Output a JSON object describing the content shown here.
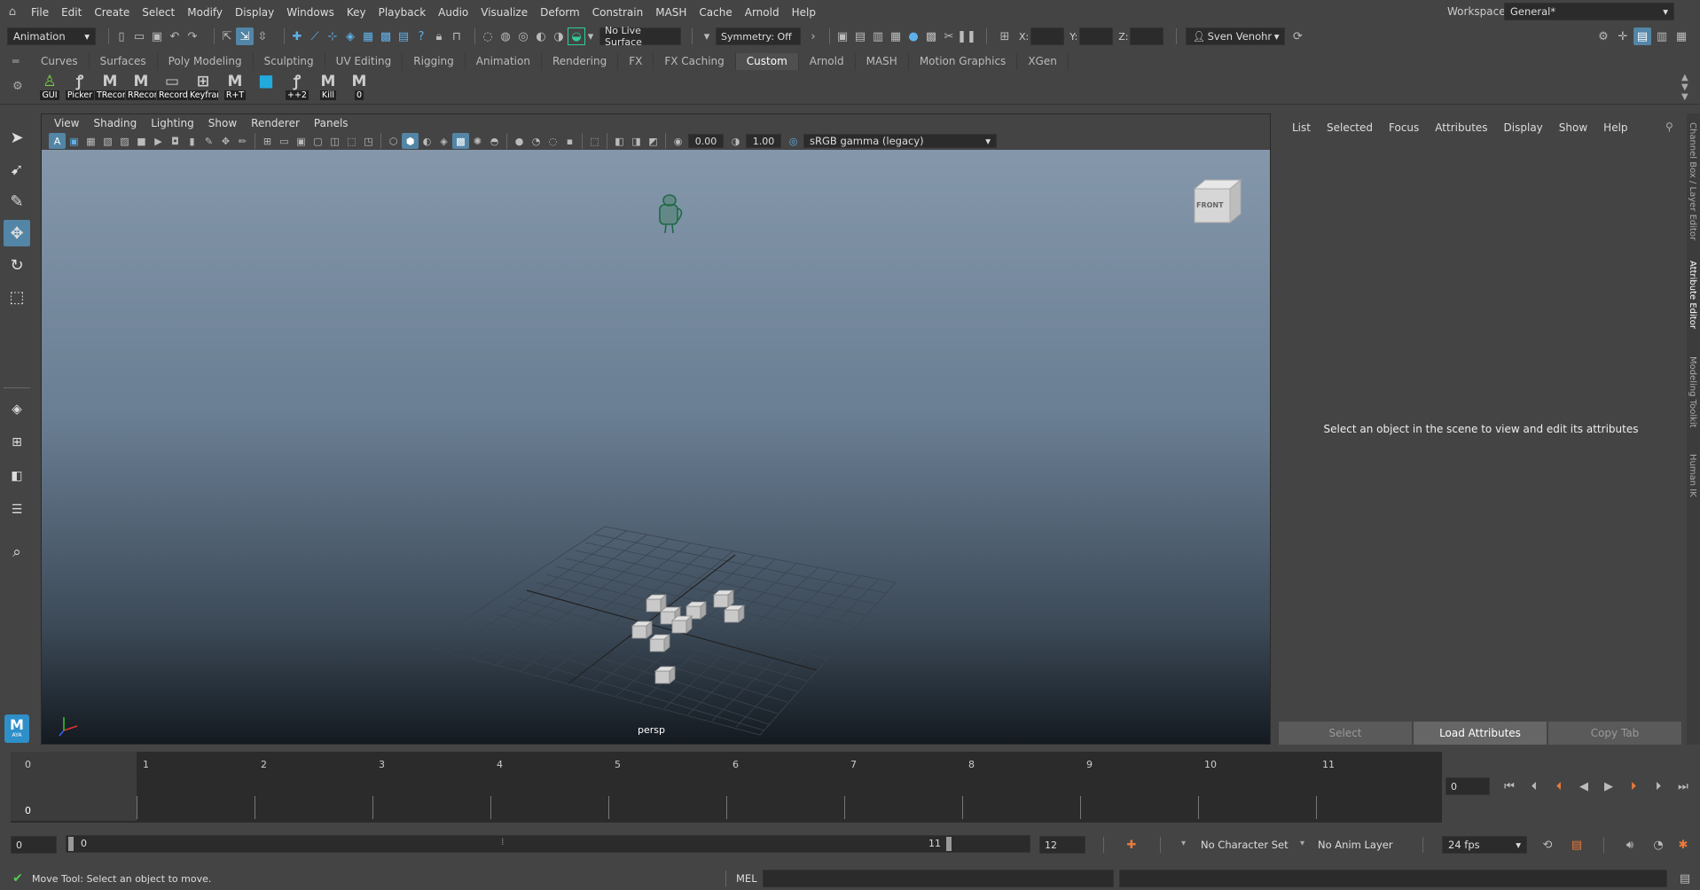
{
  "menubar": {
    "items": [
      "File",
      "Edit",
      "Create",
      "Select",
      "Modify",
      "Display",
      "Windows",
      "Key",
      "Playback",
      "Audio",
      "Visualize",
      "Deform",
      "Constrain",
      "MASH",
      "Cache",
      "Arnold",
      "Help"
    ],
    "workspace_label": "Workspace:",
    "workspace_value": "General*"
  },
  "statusline": {
    "menuset": "Animation",
    "live_surface": "No Live Surface",
    "symmetry": "Symmetry: Off",
    "x_label": "X:",
    "y_label": "Y:",
    "z_label": "Z:",
    "user": "Sven Venohr"
  },
  "shelf_tabs": [
    "Curves",
    "Surfaces",
    "Poly Modeling",
    "Sculpting",
    "UV Editing",
    "Rigging",
    "Animation",
    "Rendering",
    "FX",
    "FX Caching",
    "Custom",
    "Arnold",
    "MASH",
    "Motion Graphics",
    "XGen"
  ],
  "shelf_active_tab": "Custom",
  "shelf_buttons": [
    {
      "label": "GUI",
      "icon": "person-icon"
    },
    {
      "label": "Picker",
      "icon": "python-icon"
    },
    {
      "label": "TRecord",
      "icon": "mel-icon"
    },
    {
      "label": "RRecord",
      "icon": "mel-icon"
    },
    {
      "label": "Record",
      "icon": "record-icon"
    },
    {
      "label": "Keyframe",
      "icon": "keyframe-icon"
    },
    {
      "label": "R+T",
      "icon": "mel-icon"
    },
    {
      "label": "",
      "icon": "cube-icon"
    },
    {
      "label": "++2",
      "icon": "python-icon"
    },
    {
      "label": "Kill",
      "icon": "mel-icon"
    },
    {
      "label": "0",
      "icon": "mel-icon"
    }
  ],
  "viewport": {
    "menus": [
      "View",
      "Shading",
      "Lighting",
      "Show",
      "Renderer",
      "Panels"
    ],
    "exposure": "0.00",
    "gamma": "1.00",
    "color_space": "sRGB gamma (legacy)",
    "camera_label": "persp",
    "viewcube_label": "FRONT"
  },
  "attribute_editor": {
    "menus": [
      "List",
      "Selected",
      "Focus",
      "Attributes",
      "Display",
      "Show",
      "Help"
    ],
    "empty_message": "Select an object in the scene to view and edit its attributes",
    "btn_select": "Select",
    "btn_load": "Load Attributes",
    "btn_copy": "Copy Tab"
  },
  "side_tabs": [
    "Channel Box / Layer Editor",
    "Attribute Editor",
    "Modeling Toolkit",
    "Human IK"
  ],
  "timeline": {
    "ticks": [
      "0",
      "1",
      "2",
      "3",
      "4",
      "5",
      "6",
      "7",
      "8",
      "9",
      "10",
      "11"
    ],
    "current_frame_marker": "0",
    "current_frame": "0"
  },
  "range": {
    "start": "0",
    "slider_start": "0",
    "slider_end": "11",
    "end": "12",
    "character_set": "No Character Set",
    "anim_layer": "No Anim Layer",
    "fps": "24 fps"
  },
  "cmdline": {
    "help_text": "Move Tool: Select an object to move.",
    "lang": "MEL"
  },
  "logo_text": "M",
  "logo_sub": "AYA",
  "colors": {
    "accent": "#5285a6",
    "panel": "#444444",
    "dark": "#2b2b2b"
  }
}
